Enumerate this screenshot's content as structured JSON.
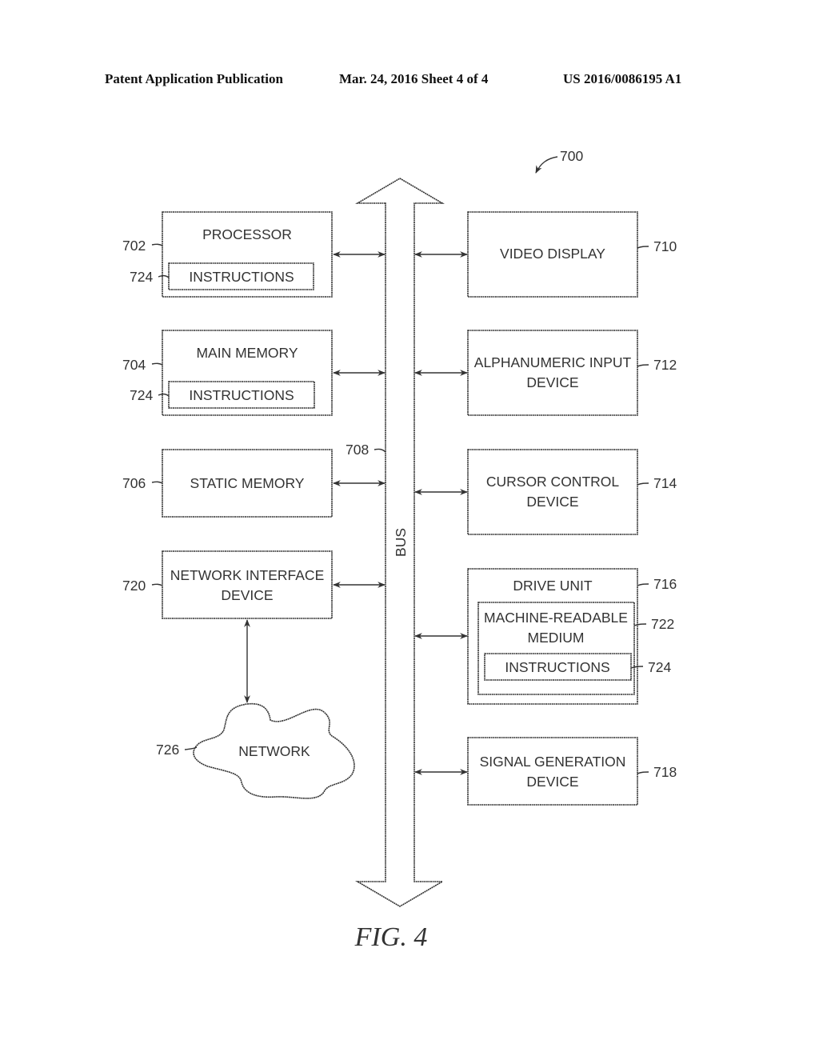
{
  "header": {
    "publication_type": "Patent Application Publication",
    "date_sheet": "Mar. 24, 2016  Sheet 4 of 4",
    "patent_number": "US 2016/0086195 A1"
  },
  "figure": {
    "system_ref": "700",
    "caption": "FIG. 4",
    "bus": {
      "label": "BUS",
      "ref": "708"
    },
    "left_blocks": [
      {
        "id": "processor",
        "lines": [
          "PROCESSOR"
        ],
        "ref": "702",
        "inner": {
          "label": "INSTRUCTIONS",
          "ref": "724"
        }
      },
      {
        "id": "main-memory",
        "lines": [
          "MAIN MEMORY"
        ],
        "ref": "704",
        "inner": {
          "label": "INSTRUCTIONS",
          "ref": "724"
        }
      },
      {
        "id": "static-memory",
        "lines": [
          "STATIC MEMORY"
        ],
        "ref": "706"
      },
      {
        "id": "network-interface-device",
        "lines": [
          "NETWORK INTERFACE",
          "DEVICE"
        ],
        "ref": "720"
      }
    ],
    "right_blocks": [
      {
        "id": "video-display",
        "lines": [
          "VIDEO DISPLAY"
        ],
        "ref": "710"
      },
      {
        "id": "alphanumeric-input-device",
        "lines": [
          "ALPHANUMERIC INPUT",
          "DEVICE"
        ],
        "ref": "712"
      },
      {
        "id": "cursor-control-device",
        "lines": [
          "CURSOR CONTROL",
          "DEVICE"
        ],
        "ref": "714"
      },
      {
        "id": "drive-unit",
        "lines": [
          "DRIVE UNIT"
        ],
        "ref": "716",
        "medium": {
          "lines": [
            "MACHINE-READABLE",
            "MEDIUM"
          ],
          "ref": "722",
          "inner": {
            "label": "INSTRUCTIONS",
            "ref": "724"
          }
        }
      },
      {
        "id": "signal-generation-device",
        "lines": [
          "SIGNAL GENERATION",
          "DEVICE"
        ],
        "ref": "718"
      }
    ],
    "network": {
      "label": "NETWORK",
      "ref": "726"
    }
  }
}
